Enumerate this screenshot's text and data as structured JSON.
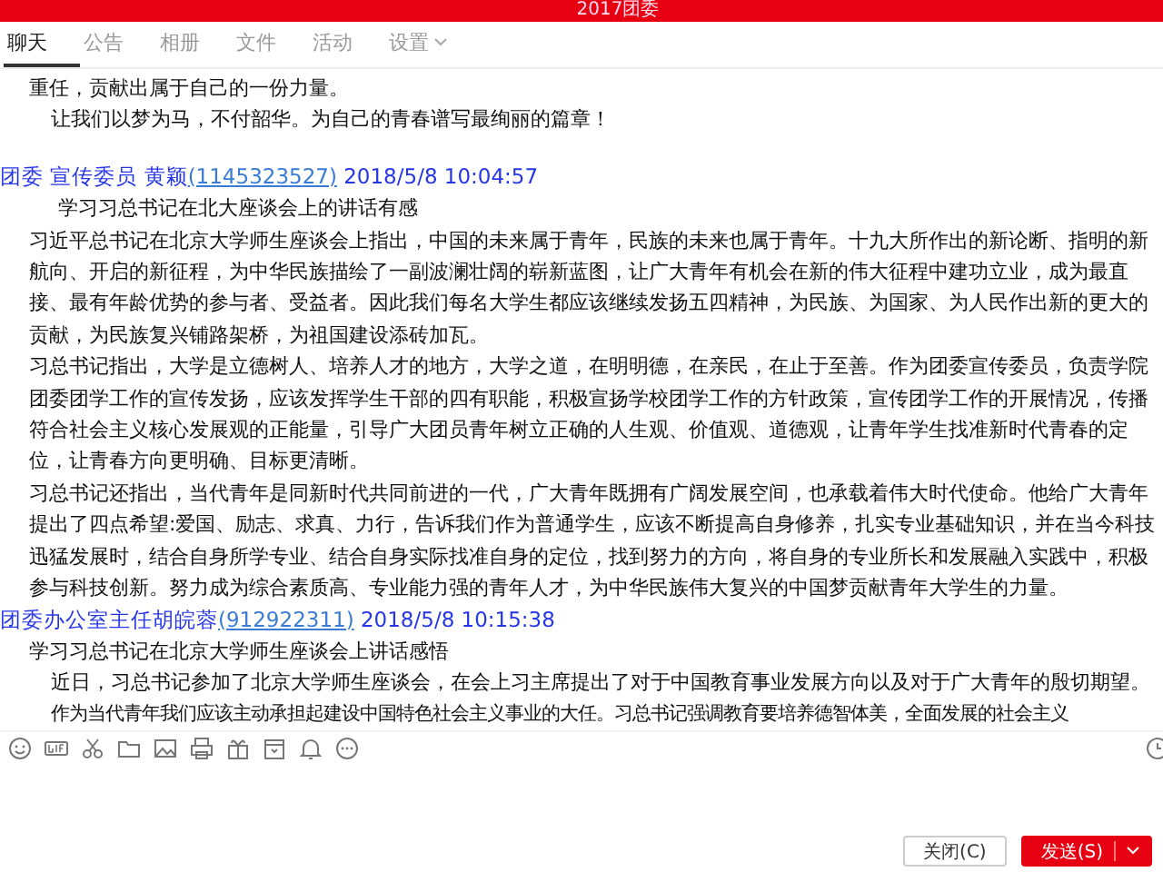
{
  "window": {
    "title": "2017团委"
  },
  "tabs": [
    {
      "label": "聊天",
      "selected": true,
      "dropdown": false
    },
    {
      "label": "公告",
      "selected": false,
      "dropdown": false
    },
    {
      "label": "相册",
      "selected": false,
      "dropdown": false
    },
    {
      "label": "文件",
      "selected": false,
      "dropdown": false
    },
    {
      "label": "活动",
      "selected": false,
      "dropdown": false
    },
    {
      "label": "设置",
      "selected": false,
      "dropdown": true
    }
  ],
  "messages": [
    {
      "paragraphs": [
        {
          "kind": "plain",
          "text": "重任，贡献出属于自己的一份力量。"
        },
        {
          "kind": "indent",
          "text": "让我们以梦为马，不付韶华。为自己的青春谱写最绚丽的篇章！"
        }
      ]
    },
    {
      "sender": "团委 宣传委员 黄颖",
      "account": "(1145323527)",
      "time": "2018/5/8 10:04:57",
      "paragraphs": [
        {
          "kind": "title",
          "text": "学习习总书记在北大座谈会上的讲话有感"
        },
        {
          "kind": "plain",
          "text": "习近平总书记在北京大学师生座谈会上指出，中国的未来属于青年，民族的未来也属于青年。十九大所作出的新论断、指明的新航向、开启的新征程，为中华民族描绘了一副波澜壮阔的崭新蓝图，让广大青年有机会在新的伟大征程中建功立业，成为最直接、最有年龄优势的参与者、受益者。因此我们每名大学生都应该继续发扬五四精神，为民族、为国家、为人民作出新的更大的贡献，为民族复兴铺路架桥，为祖国建设添砖加瓦。"
        },
        {
          "kind": "plain",
          "text": "习总书记指出，大学是立德树人、培养人才的地方，大学之道，在明明德，在亲民，在止于至善。作为团委宣传委员，负责学院团委团学工作的宣传发扬，应该发挥学生干部的四有职能，积极宣扬学校团学工作的方针政策，宣传团学工作的开展情况，传播符合社会主义核心发展观的正能量，引导广大团员青年树立正确的人生观、价值观、道德观，让青年学生找准新时代青春的定位，让青春方向更明确、目标更清晰。"
        },
        {
          "kind": "plain",
          "text": "习总书记还指出，当代青年是同新时代共同前进的一代，广大青年既拥有广阔发展空间，也承载着伟大时代使命。他给广大青年提出了四点希望:爱国、励志、求真、力行，告诉我们作为普通学生，应该不断提高自身修养，扎实专业基础知识，并在当今科技迅猛发展时，结合自身所学专业、结合自身实际找准自身的定位，找到努力的方向，将自身的专业所长和发展融入实践中，积极参与科技创新。努力成为综合素质高、专业能力强的青年人才，为中华民族伟大复兴的中国梦贡献青年大学生的力量。"
        }
      ]
    },
    {
      "sender": "团委办公室主任胡皖蓉",
      "account": "(912922311)",
      "time": "2018/5/8 10:15:38",
      "paragraphs": [
        {
          "kind": "plain",
          "text": "学习习总书记在北京大学师生座谈会上讲话感悟"
        },
        {
          "kind": "indent",
          "text": "近日，习总书记参加了北京大学师生座谈会，在会上习主席提出了对于中国教育事业发展方向以及对于广大青年的殷切期望。"
        },
        {
          "kind": "clipped",
          "text": "作为当代青年我们应该主动承担起建设中国特色社会主义事业的大任。习总书记强调教育要培养德智体美，全面发展的社会主义"
        }
      ]
    }
  ],
  "buttons": [
    {
      "kind": "plain",
      "label": "关闭(C)"
    },
    {
      "kind": "primary",
      "label": "发送(S)"
    }
  ]
}
